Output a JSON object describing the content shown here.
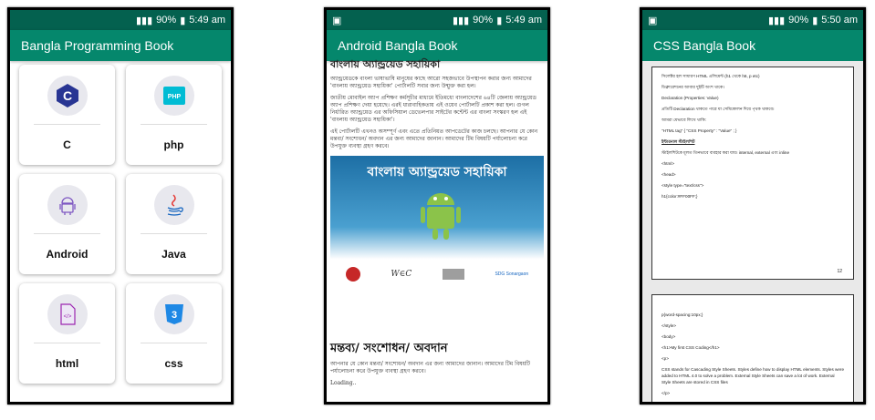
{
  "status_bar": {
    "battery": "90%",
    "time_1": "5:49 am",
    "time_2": "5:49 am",
    "time_3": "5:50 am"
  },
  "screen1": {
    "title": "Bangla Programming Book",
    "cards": [
      {
        "label": "C",
        "icon": "c-language-icon"
      },
      {
        "label": "php",
        "icon": "php-icon"
      },
      {
        "label": "Android",
        "icon": "android-icon"
      },
      {
        "label": "Java",
        "icon": "java-icon"
      },
      {
        "label": "html",
        "icon": "html-file-icon"
      },
      {
        "label": "css",
        "icon": "css3-icon"
      }
    ]
  },
  "screen2": {
    "title": "Android Bangla Book",
    "heading_top": "বাংলায় অ্যান্ড্রয়েড সহায়িকা",
    "para1": "অ্যান্ড্রয়েডকে বাংলা ভাষাভাষি মানুষের কাছে আরো সহজভাবে উপস্থাপন করার জন্য আমাদের 'বাংলায় অ্যান্ড্রয়েড সহায়িকা' পোর্টালটি সবার জন্য উন্মুক্ত করা হল।",
    "para2": "জাতীয় মোবাইল অ্যাপ প্রশিক্ষণ কর্মসূচীর মাধ্যমে ইতিমধ্যে বাংলাদেশের ৬৪টি জেলায় অ্যান্ড্রয়েড অ্যাপ প্রশিক্ষণ দেয়া হয়েছে। এরই ধারাবাহিকতায় এই ওয়েব পোর্টালটি প্রকাশ করা হল। গুগল নির্ধারিত অ্যান্ড্রয়েড এর অফিসিয়াল ডেভেলপার সাইটের কন্টেন্ট এর বাংলা সংস্করণ হল এই 'বাংলায় অ্যান্ড্রয়েড সহায়িকা'।",
    "para3": "এই পোর্টালটি এখনও অসম্পূর্ণ এবং এতে প্রতিনিয়ত আপডেটের কাজ চলছে। আপনার যে কোন মন্তব্য/ সংশোধন/ অবদান এর জন্য আমাদের জানান। আমাদের টিম বিষয়টি পর্যালোচনা করে উপযুক্ত ব্যবস্থা গ্রহণ করবে।",
    "banner_title": "বাংলায় অ্যান্ড্রয়েড সহায়িকা",
    "banner_logo_text": "SDG Sonargaon",
    "heading2": "মন্তব্য/ সংশোধন/ অবদান",
    "para4": "আপনার যে কোন মন্তব্য/ সংশোধন/ অবদান এর জন্য আমাদের জানান। আমাদের টিম বিষয়টি পর্যালোচনা করে উপযুক্ত ব্যবস্থা গ্রহণ করবে।",
    "loading": "Loading.."
  },
  "screen3": {
    "title": "CSS Bangla Book",
    "page1": [
      "সিলেক্টর হল সাধারণ HTML এলিমেন্ট (h1 থেকে h6, p etc)",
      "ডিক্লারেশনের আবার দুইটি অংশ থাকে।",
      "Declaration (Properties: Value)",
      "প্রতিটি Declaration থাকতে পারে যা সেমিকোলন দিয়ে পৃথক থাকবে।",
      "আমরা যেভাবে লিখে থাকি:",
      "\"HTML tag\" { \"CSS Property\" : \"Value\" ; }",
      "ইন্টারনাল স্টাইলশিট",
      "স্টাইলশিটকে মূলত তিনভাবে ব্যবহার করা যায়। internal, external এবং inline",
      "<html>",
      "<head>",
      "<style type=\"text/css\">",
      "h1{color:#FF00FF;}"
    ],
    "page1_number": "12",
    "page2": [
      "p{word-spacing:10px;}",
      "</style>",
      "<body>",
      "<h1>My first CSS Coding</h1>",
      "<p>",
      "CSS stands for Cascading Style Sheets. Styles define how to display HTML elements. Styles were added to HTML 4.0 to solve a problem. External Style Sheets can save a lot of work. External Style Sheets are stored in CSS files",
      "</p>"
    ]
  },
  "colors": {
    "status_bar": "#04614f",
    "app_bar": "#05876c"
  }
}
